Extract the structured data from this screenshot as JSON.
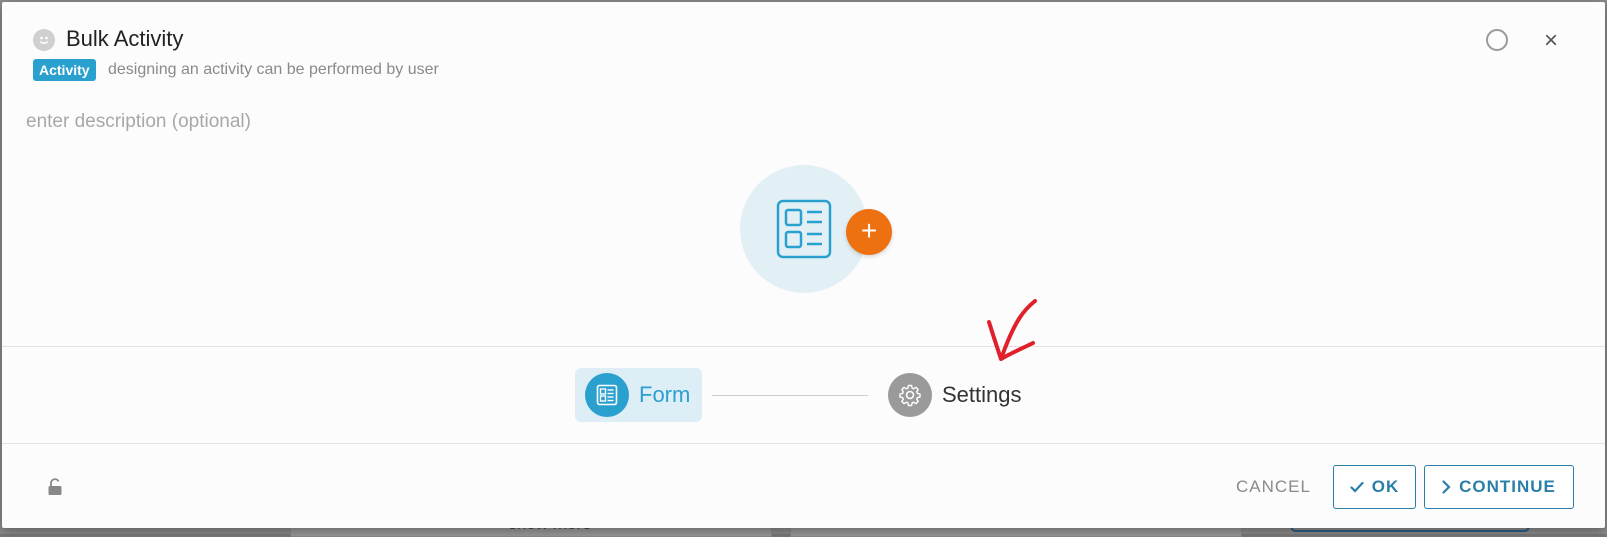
{
  "dialog": {
    "title": "Bulk Activity",
    "badge": "Activity",
    "subtitle": "designing an activity can be performed by user",
    "description_placeholder": "enter description (optional)"
  },
  "steps": [
    {
      "label": "Form",
      "icon": "form-icon",
      "active": true
    },
    {
      "label": "Settings",
      "icon": "gear-icon",
      "active": false
    }
  ],
  "footer": {
    "cancel": "CANCEL",
    "ok": "OK",
    "continue": "CONTINUE"
  },
  "background": {
    "show_more": "show more"
  },
  "colors": {
    "accent": "#2aa0cf",
    "orange": "#ee7111",
    "annotation": "#e0202a"
  }
}
